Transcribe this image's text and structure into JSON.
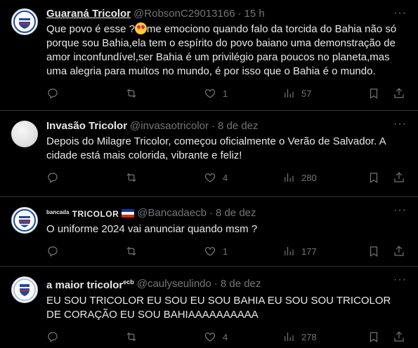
{
  "tweets": [
    {
      "name": "Guaraná Tricolor",
      "handle": "@RobsonC29013166",
      "time": "15 h",
      "text_before": "Que povo é esse ?",
      "text_after": "me emociono quando falo da torcida do Bahia não só porque sou Bahia,ela tem o espírito do povo baiano uma demonstração de amor inconfundível,ser Bahia é um privilégio para poucos no planeta,mas uma alegria para muitos no mundo, é por isso que o Bahia é o mundo.",
      "replies": "",
      "retweets": "",
      "likes": "1",
      "views": "57"
    },
    {
      "name": "Invasão Tricolor",
      "handle": "@invasaotricolor",
      "time": "8 de dez",
      "text": "Depois do Milagre Tricolor,  começou oficialmente o Verão de Salvador.  A cidade está mais colorida, vibrante e feliz!",
      "replies": "",
      "retweets": "",
      "likes": "4",
      "views": "280"
    },
    {
      "name_small": "bancada",
      "name_bold": "TRICOLOR",
      "handle": "@Bancadaecb",
      "time": "8 de dez",
      "text": "O uniforme 2024 vai anunciar quando msm ?",
      "replies": "",
      "retweets": "",
      "likes": "1",
      "views": "177"
    },
    {
      "name": "a maior tricolor",
      "name_sup": "ecb",
      "handle": "@caulyseulindo",
      "time": "8 de dez",
      "text": "EU SOU TRICOLOR EU SOU EU SOU BAHIA EU SOU SOU TRICOLOR DE CORAÇÃO EU SOU BAHIAAAAAAAAAA",
      "replies": "",
      "retweets": "",
      "likes": "4",
      "views": "278"
    }
  ],
  "separator": "·",
  "more_glyph": "···",
  "icons": {
    "reply": "reply-icon",
    "retweet": "retweet-icon",
    "like": "heart-icon",
    "views": "views-icon",
    "bookmark": "bookmark-icon",
    "share": "share-icon"
  },
  "colors": {
    "background": "#000000",
    "text": "#e7e9ea",
    "muted": "#71767b",
    "border": "#2f3336",
    "club_blue": "#1b4b9a",
    "club_red": "#d4202a"
  }
}
